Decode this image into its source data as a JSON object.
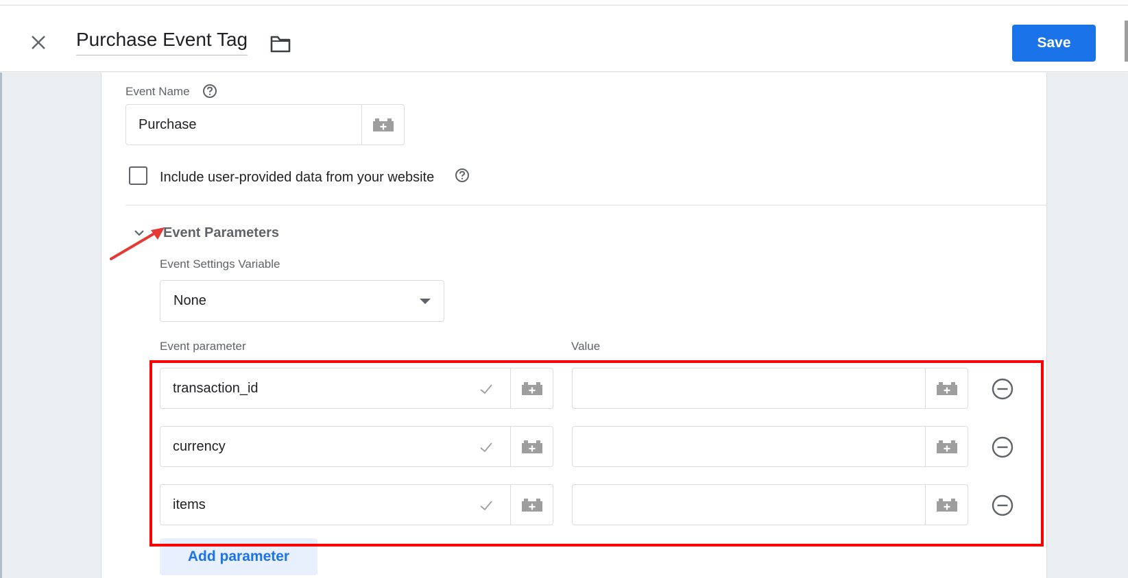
{
  "header": {
    "title": "Purchase Event Tag",
    "save_label": "Save"
  },
  "event_name": {
    "label": "Event Name",
    "value": "Purchase"
  },
  "user_data": {
    "label": "Include user-provided data from your website",
    "checked": false
  },
  "event_parameters": {
    "section_title": "Event Parameters",
    "settings_variable_label": "Event Settings Variable",
    "settings_variable_value": "None",
    "param_column_label": "Event parameter",
    "value_column_label": "Value",
    "rows": [
      {
        "parameter": "transaction_id",
        "value": ""
      },
      {
        "parameter": "currency",
        "value": ""
      },
      {
        "parameter": "items",
        "value": ""
      }
    ],
    "add_label": "Add parameter"
  },
  "colors": {
    "accent": "#1a73e8",
    "highlight": "#ff0000",
    "text_secondary": "#5f6368"
  },
  "icons": {
    "close": "close-icon",
    "folder": "folder-icon",
    "help": "help-icon",
    "variable": "variable-brick-icon",
    "check": "check-icon",
    "remove": "remove-circle-icon",
    "chevron": "chevron-down-icon"
  }
}
